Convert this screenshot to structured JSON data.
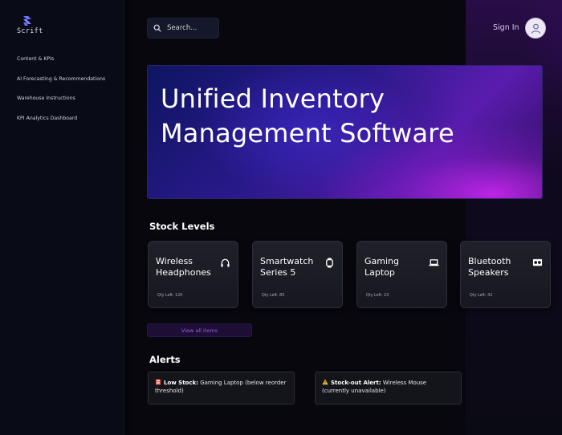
{
  "app": {
    "logo_text": "Scrift"
  },
  "sidebar": {
    "items": [
      {
        "label": "Content & KPIs"
      },
      {
        "label": "AI Forecasting & Recommendations"
      },
      {
        "label": "Warehouse Instructions"
      },
      {
        "label": "KPI Analytics Dashboard"
      }
    ]
  },
  "header": {
    "search": {
      "placeholder": "Search...",
      "value": ""
    },
    "sign_in_label": "Sign In",
    "avatar_icon": "user-icon"
  },
  "hero": {
    "title": "Unified Inventory Management Software"
  },
  "stock": {
    "title": "Stock Levels",
    "items": [
      {
        "name": "Wireless Headphones",
        "qty": "Qty Left: 120",
        "icon": "headphones-icon"
      },
      {
        "name": "Smartwatch Series 5",
        "qty": "Qty Left: 85",
        "icon": "smartwatch-icon"
      },
      {
        "name": "Gaming Laptop",
        "qty": "Qty Left: 23",
        "icon": "laptop-icon"
      },
      {
        "name": "Bluetooth Speakers",
        "qty": "Qty Left: 42",
        "icon": "speaker-icon"
      }
    ],
    "view_all_label": "View all items"
  },
  "alerts": {
    "title": "Alerts",
    "items": [
      {
        "label": "Low Stock:",
        "text": "Gaming Laptop (below reorder threshold)",
        "icon": "low-stock-icon"
      },
      {
        "label": "Stock-out Alert:",
        "text": "Wireless Mouse (currently unavailable)",
        "icon": "warning-icon"
      }
    ]
  },
  "colors": {
    "accent": "#a05bf0",
    "sidebar_bg": "#090c17",
    "page_bg": "#07070d"
  }
}
